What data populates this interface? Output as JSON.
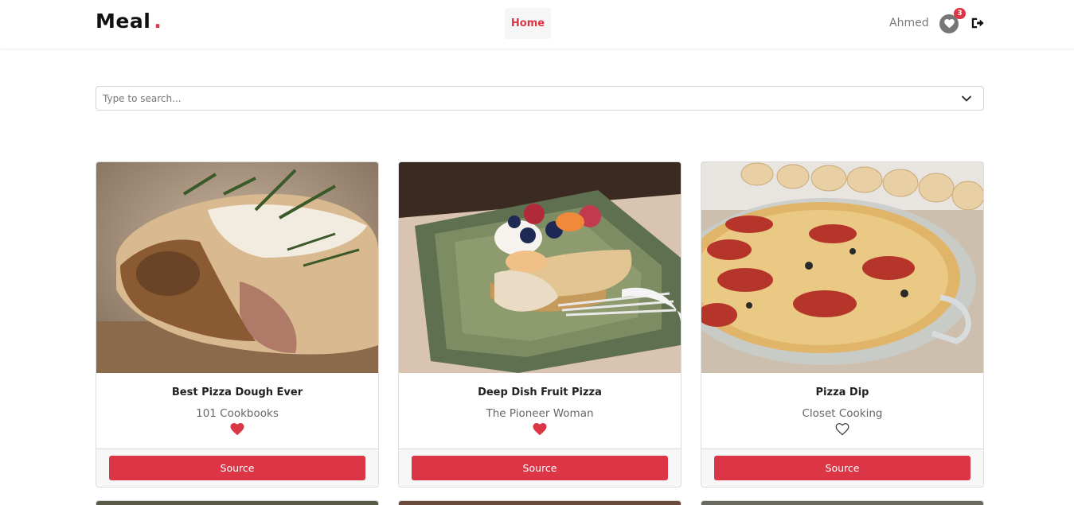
{
  "navbar": {
    "brand": "Meal",
    "brand_dot": ".",
    "home_label": "Home",
    "username": "Ahmed",
    "favorites_count": "3",
    "favorites_icon": "heart-icon",
    "logout_icon": "sign-out-icon"
  },
  "search": {
    "placeholder": "Type to search...",
    "value": "",
    "dropdown_icon": "chevron-down-icon"
  },
  "colors": {
    "accent": "#dc3545",
    "muted_text": "#777777"
  },
  "recipes": [
    {
      "title": "Best Pizza Dough Ever",
      "publisher": "101 Cookbooks",
      "favorited": true,
      "source_label": "Source"
    },
    {
      "title": "Deep Dish Fruit Pizza",
      "publisher": "The Pioneer Woman",
      "favorited": true,
      "source_label": "Source"
    },
    {
      "title": "Pizza Dip",
      "publisher": "Closet Cooking",
      "favorited": false,
      "source_label": "Source"
    }
  ]
}
